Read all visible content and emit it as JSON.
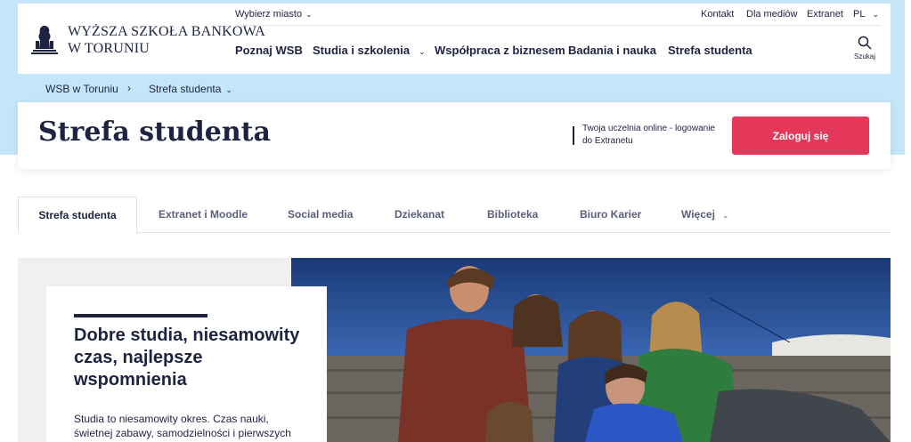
{
  "colors": {
    "navy": "#1d2340",
    "light_blue_band": "#c5e6f8",
    "login_button": "#e4385a",
    "hero_panel": "#f0f0f2"
  },
  "logo": {
    "line1": "WYŻSZA SZKOŁA BANKOWA",
    "line2": "W TORUNIU",
    "emblem_icon": "university-emblem-icon"
  },
  "top_bar": {
    "city_selector": "Wybierz miasto",
    "links": [
      "Kontakt",
      "Dla mediów",
      "Extranet"
    ],
    "language": "PL"
  },
  "nav": {
    "items": [
      "Poznaj WSB",
      "Studia i szkolenia",
      "Współpraca z biznesem",
      "Badania i nauka",
      "Strefa studenta"
    ],
    "search_label": "Szukaj",
    "search_icon": "search-icon"
  },
  "breadcrumb": {
    "home": "WSB w Toruniu",
    "separator": "›",
    "current": "Strefa studenta"
  },
  "title_card": {
    "title": "Strefa studenta",
    "login_description": "Twoja uczelnia online - logowanie do Extranetu",
    "login_button": "Zaloguj się"
  },
  "tabs": [
    "Strefa studenta",
    "Extranet i Moodle",
    "Social media",
    "Dziekanat",
    "Biblioteka",
    "Biuro Karier",
    "Więcej"
  ],
  "active_tab": "Strefa studenta",
  "hero": {
    "title": "Dobre studia, niesamowity czas, najlepsze wspomnienia",
    "text": "Studia to niesamowity okres. Czas nauki, świetnej zabawy, samodzielności i pierwszych poważnych",
    "photo_description_icon": "students-group-photo"
  }
}
